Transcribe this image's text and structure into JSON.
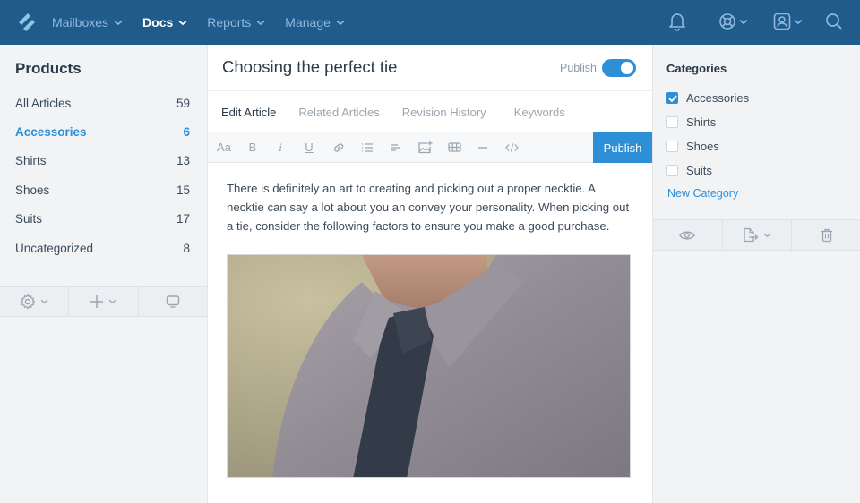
{
  "colors": {
    "nav_bg": "#1f5c8c",
    "accent": "#2d8fd6",
    "sidebar_bg": "#f1f3f5"
  },
  "nav": {
    "logo": "helpscout-logo-icon",
    "items": [
      {
        "label": "Mailboxes",
        "active": false
      },
      {
        "label": "Docs",
        "active": true
      },
      {
        "label": "Reports",
        "active": false
      },
      {
        "label": "Manage",
        "active": false
      }
    ],
    "right_icons": [
      "bell-icon",
      "lifebuoy-icon",
      "user-profile-icon",
      "search-icon"
    ]
  },
  "left_sidebar": {
    "title": "Products",
    "categories": [
      {
        "name": "All Articles",
        "count": "59",
        "active": false
      },
      {
        "name": "Accessories",
        "count": "6",
        "active": true
      },
      {
        "name": "Shirts",
        "count": "13",
        "active": false
      },
      {
        "name": "Shoes",
        "count": "15",
        "active": false
      },
      {
        "name": "Suits",
        "count": "17",
        "active": false
      },
      {
        "name": "Uncategorized",
        "count": "8",
        "active": false
      }
    ],
    "tools": [
      "settings-icon",
      "add-icon",
      "monitor-icon"
    ]
  },
  "editor": {
    "title": "Choosing the perfect tie",
    "publish_toggle_label": "Publish",
    "publish_toggle_on": true,
    "tabs": [
      {
        "label": "Edit Article",
        "active": true
      },
      {
        "label": "Related Articles",
        "active": false
      },
      {
        "label": "Revision History",
        "active": false
      },
      {
        "label": "Keywords",
        "active": false
      }
    ],
    "toolbar": {
      "font_label": "Aa",
      "bold_label": "B",
      "italic_label": "i",
      "underline_label": "U",
      "publish_label": "Publish"
    },
    "body": "There is definitely an art to creating and picking out a proper necktie. A necktie can say a lot about you an convey your personality. When picking out a tie, consider the following factors to ensure you make a good purchase.",
    "image_alt": "Man wearing a gray shirt and dark navy necktie"
  },
  "right_sidebar": {
    "title": "Categories",
    "categories": [
      {
        "name": "Accessories",
        "checked": true
      },
      {
        "name": "Shirts",
        "checked": false
      },
      {
        "name": "Shoes",
        "checked": false
      },
      {
        "name": "Suits",
        "checked": false
      }
    ],
    "new_category_label": "New Category",
    "tools": [
      "preview-eye-icon",
      "export-icon",
      "trash-icon"
    ]
  }
}
